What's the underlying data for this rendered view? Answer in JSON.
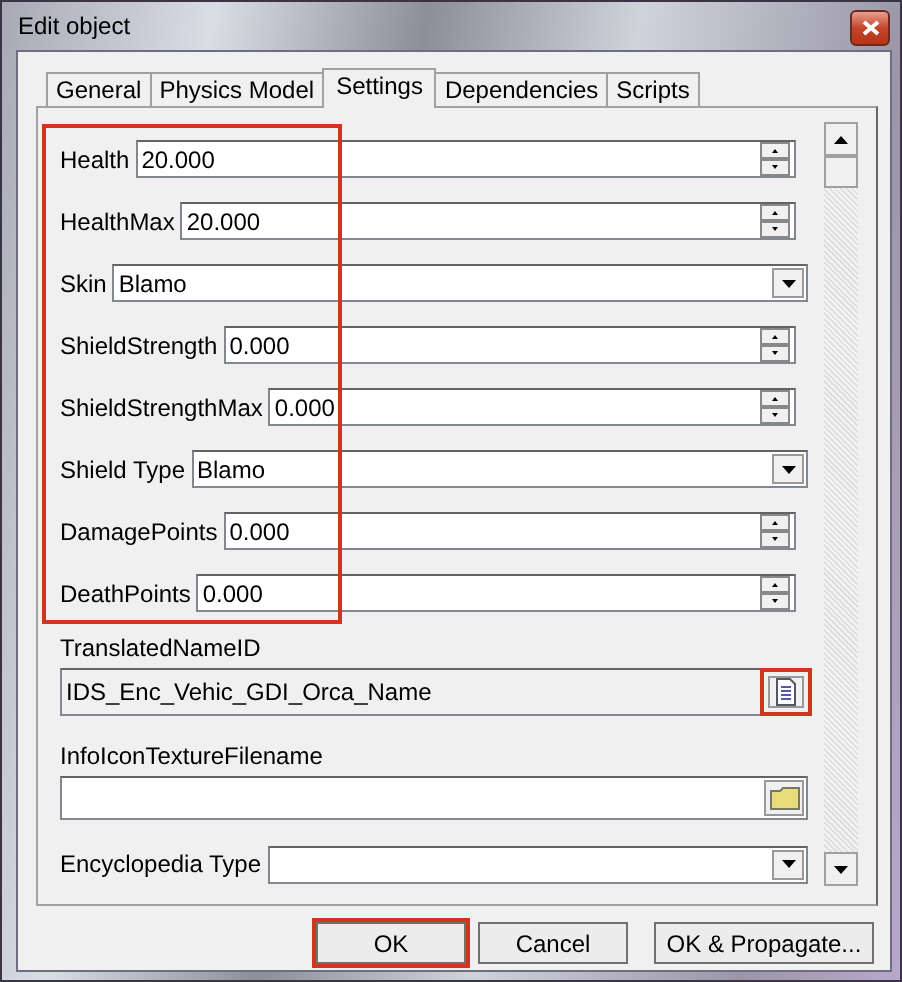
{
  "window": {
    "title": "Edit object"
  },
  "tabs": [
    {
      "label": "General",
      "selected": false
    },
    {
      "label": "Physics Model",
      "selected": false
    },
    {
      "label": "Settings",
      "selected": true
    },
    {
      "label": "Dependencies",
      "selected": false
    },
    {
      "label": "Scripts",
      "selected": false
    }
  ],
  "settings": {
    "highlighted": true,
    "fields": [
      {
        "kind": "spin",
        "label": "Health",
        "value": "20.000"
      },
      {
        "kind": "spin",
        "label": "HealthMax",
        "value": "20.000"
      },
      {
        "kind": "combo",
        "label": "Skin",
        "value": "Blamo"
      },
      {
        "kind": "spin",
        "label": "ShieldStrength",
        "value": "0.000"
      },
      {
        "kind": "spin",
        "label": "ShieldStrengthMax",
        "value": "0.000"
      },
      {
        "kind": "combo",
        "label": "Shield Type",
        "value": "Blamo"
      },
      {
        "kind": "spin",
        "label": "DamagePoints",
        "value": "0.000"
      },
      {
        "kind": "spin",
        "label": "DeathPoints",
        "value": "0.000"
      }
    ]
  },
  "stacked_fields": [
    {
      "kind": "string",
      "label": "TranslatedNameID",
      "value": "IDS_Enc_Vehic_GDI_Orca_Name",
      "disabled": true,
      "button_highlighted": true
    },
    {
      "kind": "file",
      "label": "InfoIconTextureFilename",
      "disabled": false,
      "button_highlighted": false
    }
  ],
  "encyclopedia": {
    "label": "Encyclopedia Type"
  },
  "buttons": [
    {
      "label": "OK",
      "highlighted": true
    },
    {
      "label": "Cancel",
      "highlighted": false
    },
    {
      "label": "OK & Propagate...",
      "highlighted": false
    }
  ]
}
